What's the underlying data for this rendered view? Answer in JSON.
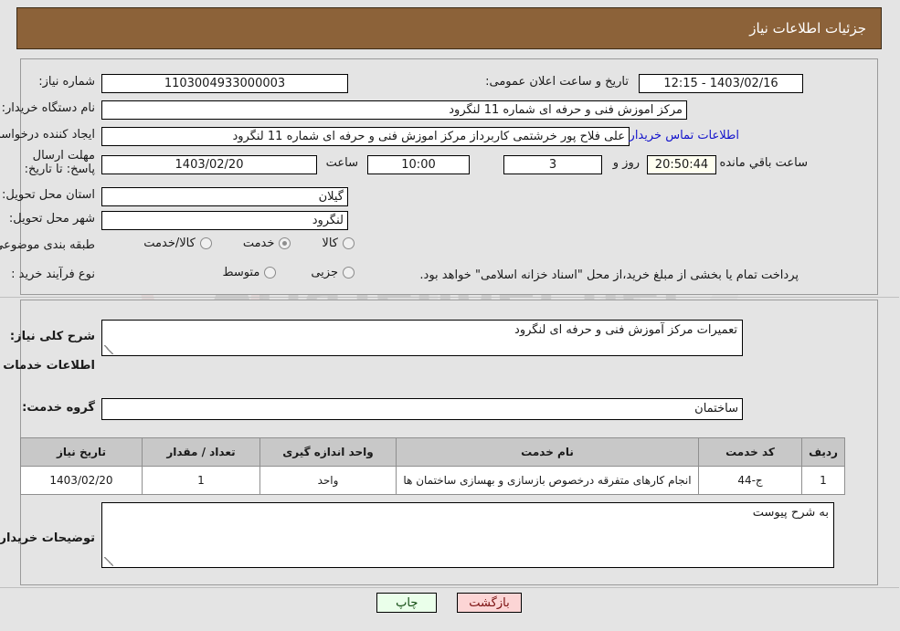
{
  "header": {
    "title": "جزئیات اطلاعات نیاز"
  },
  "form": {
    "need_number_label": "شماره نیاز:",
    "need_number_value": "1103004933000003",
    "announce_datetime_label": "تاریخ و ساعت اعلان عمومی:",
    "announce_datetime_value": "1403/02/16 - 12:15",
    "buyer_org_label": "نام دستگاه خریدار:",
    "buyer_org_value": "مرکز اموزش فنی و حرفه ای شماره 11  لنگرود",
    "requester_label": "ایجاد کننده درخواست:",
    "requester_value": "علی  فلاح پور خرشتمی کاربرداز مرکز اموزش فنی و حرفه ای شماره 11  لنگرود",
    "contact_link": "اطلاعات تماس خریدار",
    "deadline_label": "مهلت ارسال پاسخ: تا تاریخ:",
    "deadline_date": "1403/02/20",
    "deadline_hour_label": "ساعت",
    "deadline_hour_value": "10:00",
    "remaining_days_value": "3",
    "remaining_days_label": "روز و",
    "remaining_timer_value": "20:50:44",
    "remaining_timer_label": "ساعت باقي مانده",
    "province_label": "استان محل تحویل:",
    "province_value": "گیلان",
    "city_label": "شهر محل تحویل:",
    "city_value": "لنگرود",
    "category_label": "طبقه بندی موضوعی:",
    "category_options": [
      {
        "label": "کالا",
        "selected": false
      },
      {
        "label": "خدمت",
        "selected": true
      },
      {
        "label": "کالا/خدمت",
        "selected": false
      }
    ],
    "process_label": "نوع فرآیند خرید :",
    "process_options": [
      {
        "label": "جزیی",
        "selected": false
      },
      {
        "label": "متوسط",
        "selected": false
      }
    ],
    "process_note": "پرداخت تمام یا بخشی از مبلغ خرید،از محل \"اسناد خزانه اسلامی\" خواهد بود."
  },
  "details": {
    "summary_label": "شرح کلی نیاز:",
    "summary_value": "تعمیرات مرکز آموزش فنی و حرفه ای لنگرود",
    "services_heading": "اطلاعات خدمات مورد نیاز",
    "service_group_label": "گروه خدمت:",
    "service_group_value": "ساختمان",
    "comments_label": "توضیحات خریدار:",
    "comments_value": "به شرح پیوست"
  },
  "table": {
    "headers": [
      "ردیف",
      "کد خدمت",
      "نام خدمت",
      "واحد اندازه گیری",
      "تعداد / مقدار",
      "تاریخ نیاز"
    ],
    "rows": [
      {
        "index": "1",
        "code": "ج-44",
        "name": "انجام کارهای متفرقه درخصوص بازسازی و بهسازی ساختمان ها",
        "unit": "واحد",
        "quantity": "1",
        "date": "1403/02/20"
      }
    ]
  },
  "footer": {
    "print_label": "چاپ",
    "back_label": "بازگشت"
  },
  "watermark": {
    "text": "AriaTender.net"
  },
  "colors": {
    "header_bg": "#8c6239",
    "page_bg": "#e4e4e4",
    "link": "#1414cc",
    "timer_bg": "#fffff0",
    "table_header_bg": "#c8c8c8",
    "print_btn_bg": "#eaffea",
    "back_btn_bg": "#fcd5d5"
  }
}
